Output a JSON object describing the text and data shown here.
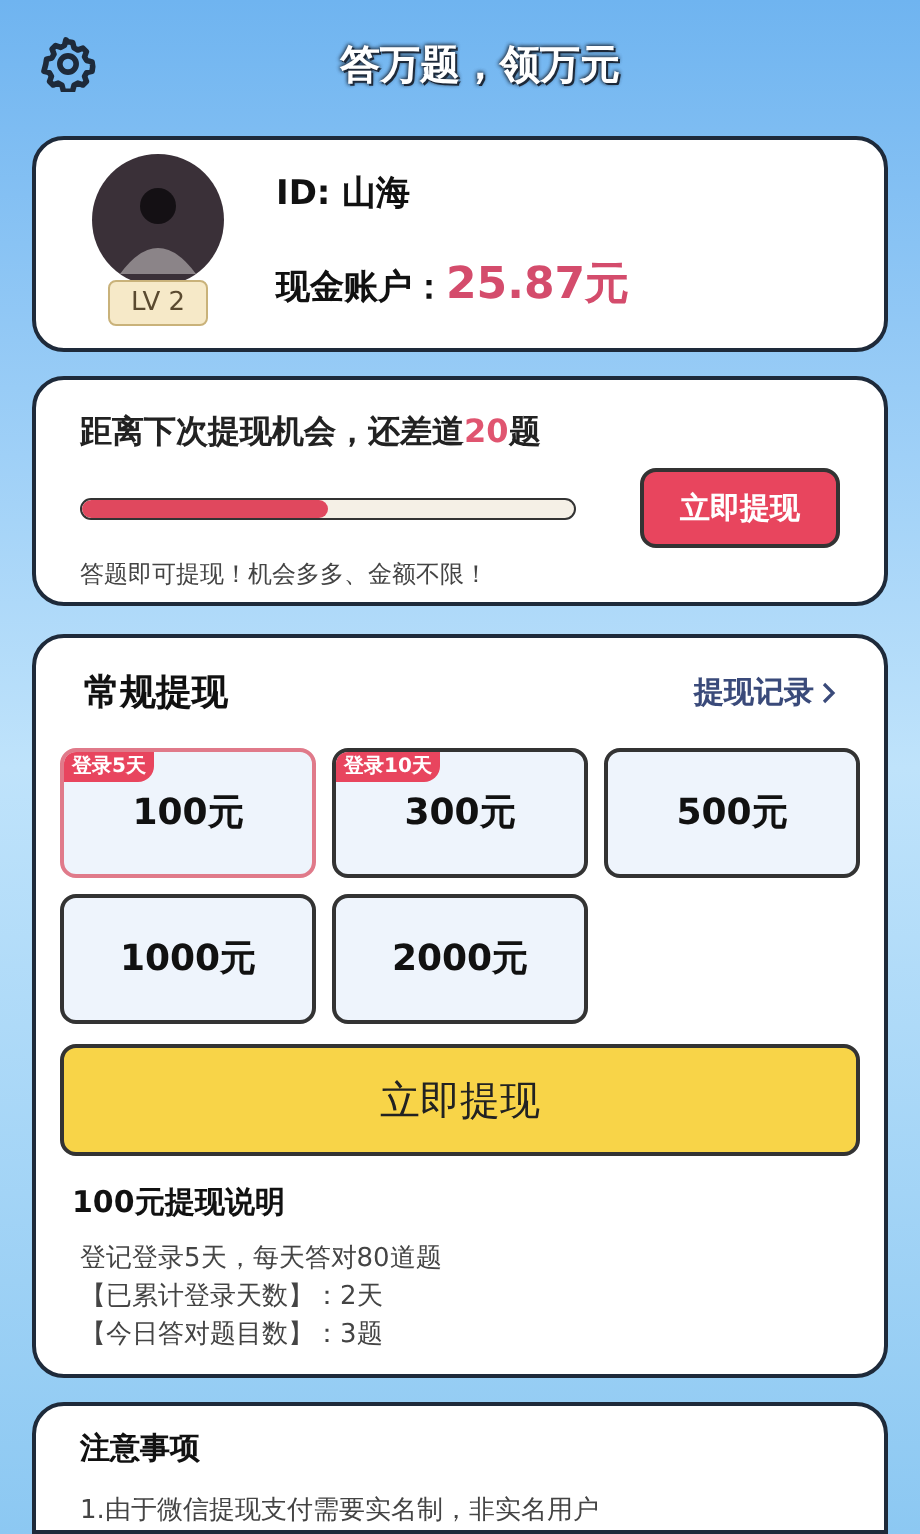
{
  "header": {
    "title": "答万题，领万元"
  },
  "profile": {
    "id_label": "ID: 山海",
    "level_badge": "LV 2",
    "balance_label": "现金账户：",
    "balance": "25.87元"
  },
  "progress_card": {
    "prefix": "距离下次提现机会，还差道",
    "count": "20",
    "suffix": "题",
    "level": 0.5,
    "button": "立即提现",
    "note": "答题即可提现！机会多多、金额不限！"
  },
  "withdraw": {
    "title": "常规提现",
    "records_link": "提现记录",
    "options": [
      {
        "amount": "100元",
        "tag": "登录5天",
        "selected": true
      },
      {
        "amount": "300元",
        "tag": "登录10天",
        "selected": false
      },
      {
        "amount": "500元",
        "selected": false
      },
      {
        "amount": "1000元",
        "selected": false
      },
      {
        "amount": "2000元",
        "selected": false
      }
    ],
    "button": "立即提现",
    "explain_title": "100元提现说明",
    "explain_lines": [
      "登记登录5天，每天答对80道题",
      "【已累计登录天数】：2天",
      "【今日答对题目数】：3题"
    ]
  },
  "notice": {
    "title": "注意事项",
    "lines": [
      "1.由于微信提现支付需要实名制，非实名用户"
    ]
  }
}
